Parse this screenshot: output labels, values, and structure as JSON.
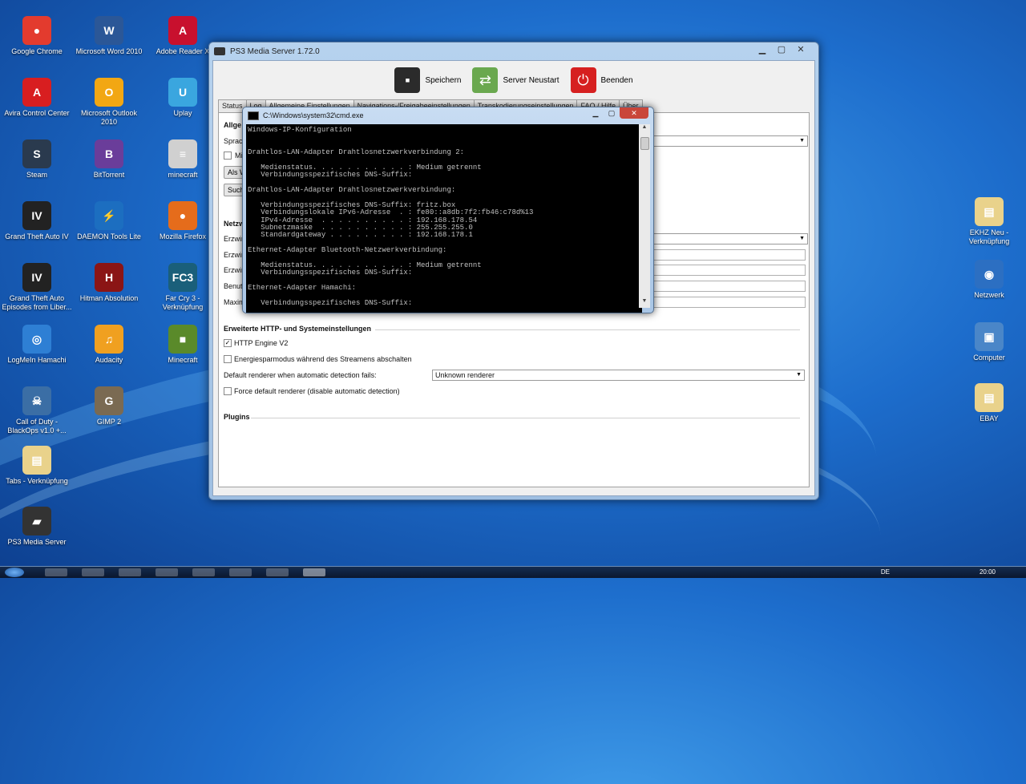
{
  "desktop": {
    "icons_left": [
      {
        "label": "Google Chrome",
        "glyph": "●",
        "color": "#e33b2e"
      },
      {
        "label": "Microsoft Word 2010",
        "glyph": "W",
        "color": "#2b5797"
      },
      {
        "label": "Adobe Reader X",
        "glyph": "A",
        "color": "#c8102e"
      },
      {
        "label": "Avira Control Center",
        "glyph": "A",
        "color": "#d81e20"
      },
      {
        "label": "Microsoft Outlook 2010",
        "glyph": "O",
        "color": "#f2a713"
      },
      {
        "label": "Uplay",
        "glyph": "U",
        "color": "#3aa6df"
      },
      {
        "label": "Steam",
        "glyph": "S",
        "color": "#2a3a4e"
      },
      {
        "label": "BitTorrent",
        "glyph": "B",
        "color": "#6a3d9a"
      },
      {
        "label": "minecraft",
        "glyph": "≡",
        "color": "#d0d0d0"
      },
      {
        "label": "Grand Theft Auto IV",
        "glyph": "IV",
        "color": "#222"
      },
      {
        "label": "DAEMON Tools Lite",
        "glyph": "⚡",
        "color": "#1c6ec0"
      },
      {
        "label": "Mozilla Firefox",
        "glyph": "●",
        "color": "#e56c1b"
      },
      {
        "label": "Grand Theft Auto Episodes from Liber...",
        "glyph": "IV",
        "color": "#222"
      },
      {
        "label": "Hitman Absolution",
        "glyph": "H",
        "color": "#8b1515"
      },
      {
        "label": "Far Cry 3 - Verknüpfung",
        "glyph": "FC3",
        "color": "#1a5f7a"
      },
      {
        "label": "LogMeIn Hamachi",
        "glyph": "◎",
        "color": "#2e7fd4"
      },
      {
        "label": "Audacity",
        "glyph": "♫",
        "color": "#f0a020"
      },
      {
        "label": "Minecraft",
        "glyph": "■",
        "color": "#5a8a2a"
      },
      {
        "label": "Call of Duty - BlackOps v1.0 +...",
        "glyph": "☠",
        "color": "#3b6ea5"
      },
      {
        "label": "GIMP 2",
        "glyph": "G",
        "color": "#7a6a52"
      },
      {
        "label": "Tabs - Verknüpfung",
        "glyph": "▤",
        "color": "#e9d28b"
      },
      {
        "label": "PS3 Media Server",
        "glyph": "▰",
        "color": "#333"
      }
    ],
    "icons_right": [
      {
        "label": "EKHZ Neu - Verknüpfung",
        "glyph": "▤",
        "color": "#e9d28b"
      },
      {
        "label": "Netzwerk",
        "glyph": "◉",
        "color": "#2c6fc2"
      },
      {
        "label": "Computer",
        "glyph": "▣",
        "color": "#4a86c8"
      },
      {
        "label": "EBAY",
        "glyph": "▤",
        "color": "#e9d28b"
      }
    ]
  },
  "pms": {
    "title": "PS3 Media Server 1.72.0",
    "toolbar": {
      "save": "Speichern",
      "restart": "Server Neustart",
      "quit": "Beenden"
    },
    "tabs": [
      "Status",
      "Log",
      "Allgemeine Einstellungen",
      "Navigations-/Freigabeeinstellungen",
      "Transkodierungseinstellungen",
      "FAQ / Hilfe",
      "Über"
    ],
    "general": {
      "heading": "Allge",
      "lang": "Sprac",
      "mi": "Mi",
      "asbtn": "Als W",
      "suchbtn": "Such"
    },
    "network": {
      "heading": "Netzw",
      "rows": [
        "Erzwin",
        "Erzwin",
        "Erzwin",
        "Benut",
        "Maxim"
      ]
    },
    "http": {
      "heading": "Erweiterte HTTP- und Systemeinstellungen",
      "engine_v2": "HTTP Engine V2",
      "energy": "Energiesparmodus während des Streamens abschalten",
      "renderer_label": "Default renderer when automatic detection fails:",
      "renderer_value": "Unknown renderer",
      "force_renderer": "Force default renderer (disable automatic detection)"
    },
    "plugins_heading": "Plugins"
  },
  "cmd": {
    "title": "C:\\Windows\\system32\\cmd.exe",
    "lines": [
      "Windows-IP-Konfiguration",
      "",
      "",
      "Drahtlos-LAN-Adapter Drahtlosnetzwerkverbindung 2:",
      "",
      "   Medienstatus. . . . . . . . . . . : Medium getrennt",
      "   Verbindungsspezifisches DNS-Suffix:",
      "",
      "Drahtlos-LAN-Adapter Drahtlosnetzwerkverbindung:",
      "",
      "   Verbindungsspezifisches DNS-Suffix: fritz.box",
      "   Verbindungslokale IPv6-Adresse  . : fe80::a8db:7f2:fb46:c78d%13",
      "   IPv4-Adresse  . . . . . . . . . . : 192.168.178.54",
      "   Subnetzmaske  . . . . . . . . . . : 255.255.255.0",
      "   Standardgateway . . . . . . . . . : 192.168.178.1",
      "",
      "Ethernet-Adapter Bluetooth-Netzwerkverbindung:",
      "",
      "   Medienstatus. . . . . . . . . . . : Medium getrennt",
      "   Verbindungsspezifisches DNS-Suffix:",
      "",
      "Ethernet-Adapter Hamachi:",
      "",
      "   Verbindungsspezifisches DNS-Suffix:"
    ]
  },
  "taskbar": {
    "lang": "DE",
    "time": "20:00"
  }
}
